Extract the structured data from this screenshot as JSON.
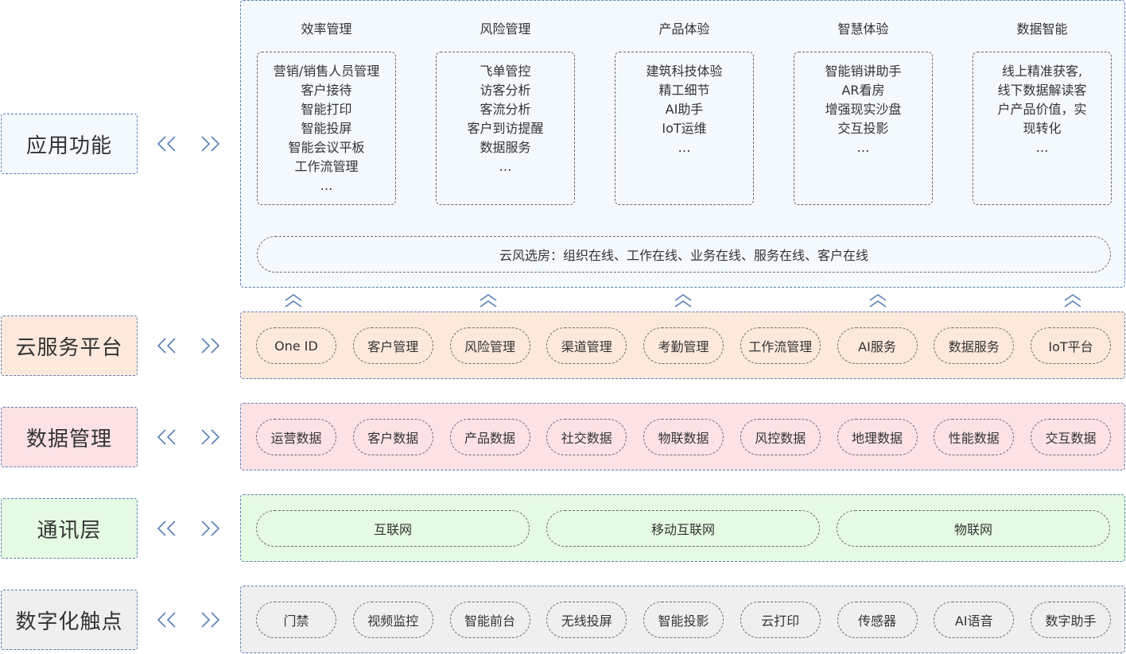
{
  "layers": {
    "app": {
      "label": "应用功能",
      "columns": [
        {
          "title": "效率管理",
          "items": [
            "营销/销售人员管理",
            "客户接待",
            "智能打印",
            "智能投屏",
            "智能会议平板",
            "工作流管理",
            "…"
          ]
        },
        {
          "title": "风险管理",
          "items": [
            "飞单管控",
            "访客分析",
            "客流分析",
            "客户到访提醒",
            "数据服务",
            "…"
          ]
        },
        {
          "title": "产品体验",
          "items": [
            "建筑科技体验",
            "精工细节",
            "AI助手",
            "IoT运维",
            "…"
          ]
        },
        {
          "title": "智慧体验",
          "items": [
            "智能销讲助手",
            "AR看房",
            "增强现实沙盘",
            "交互投影",
            "…"
          ]
        },
        {
          "title": "数据智能",
          "items": [
            "线上精准获客,",
            "线下数据解读客",
            "户产品价值，实",
            "现转化",
            "…"
          ]
        }
      ],
      "banner": "云风选房：组织在线、工作在线、业务在线、服务在线、客户在线"
    },
    "cloud": {
      "label": "云服务平台",
      "items": [
        "One ID",
        "客户管理",
        "风险管理",
        "渠道管理",
        "考勤管理",
        "工作流管理",
        "AI服务",
        "数据服务",
        "IoT平台"
      ]
    },
    "data": {
      "label": "数据管理",
      "items": [
        "运营数据",
        "客户数据",
        "产品数据",
        "社交数据",
        "物联数据",
        "风控数据",
        "地理数据",
        "性能数据",
        "交互数据"
      ]
    },
    "comm": {
      "label": "通讯层",
      "items": [
        "互联网",
        "移动互联网",
        "物联网"
      ]
    },
    "touch": {
      "label": "数字化触点",
      "items": [
        "门禁",
        "视频监控",
        "智能前台",
        "无线投屏",
        "智能投影",
        "云打印",
        "传感器",
        "AI语音",
        "数字助手"
      ]
    }
  },
  "colors": {
    "border_blue": "#5b7fb8",
    "app_bg": "#f3f9fd",
    "cloud_bg": "#fde9dc",
    "data_bg": "#fde2e5",
    "comm_bg": "#e6fbe3",
    "touch_bg": "#efefef",
    "arrow": "#5b7fb8"
  },
  "icons": {
    "side_arrows": "double-chevron-left-right-icon",
    "up_arrows": "double-chevron-up-icon"
  }
}
